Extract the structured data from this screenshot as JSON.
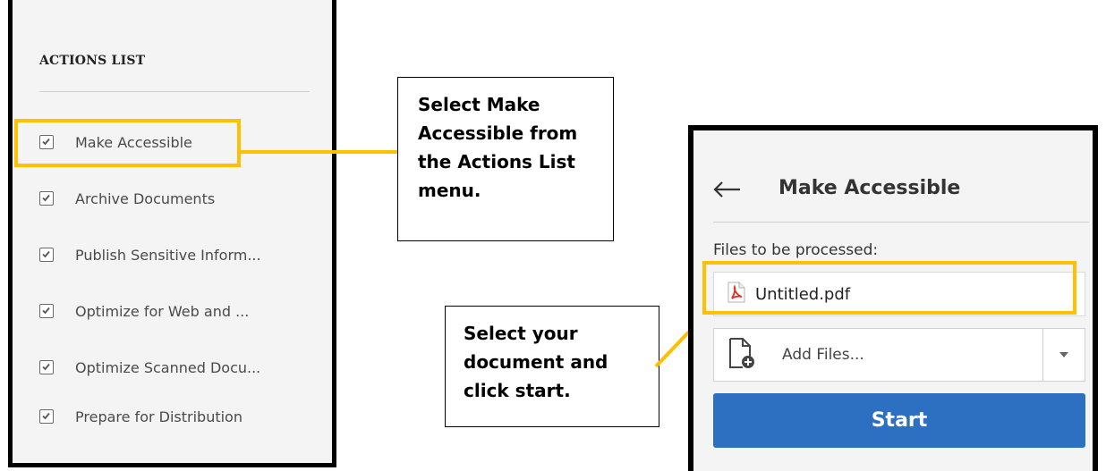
{
  "actions_list": {
    "title": "ACTIONS LIST",
    "items": [
      {
        "label": "Make Accessible"
      },
      {
        "label": "Archive Documents"
      },
      {
        "label": "Publish Sensitive Inform..."
      },
      {
        "label": "Optimize for Web and ..."
      },
      {
        "label": "Optimize Scanned Docu..."
      },
      {
        "label": "Prepare for Distribution"
      }
    ]
  },
  "callouts": {
    "step1": [
      "Select Make",
      "Accessible from",
      "the Actions List",
      "menu."
    ],
    "step2": [
      "Select your",
      "document and",
      "click start."
    ]
  },
  "make_accessible_panel": {
    "title": "Make Accessible",
    "files_label": "Files to be processed:",
    "file_name": "Untitled.pdf",
    "add_files_label": "Add Files...",
    "start_label": "Start"
  },
  "colors": {
    "highlight": "#ffc000",
    "start_button": "#2d6fc0",
    "panel_background": "#f4f4f4",
    "pdf_icon": "#d93025"
  },
  "icons": [
    "checkbox-icon",
    "back-arrow-icon",
    "pdf-file-icon",
    "add-file-icon",
    "chevron-down-icon"
  ]
}
